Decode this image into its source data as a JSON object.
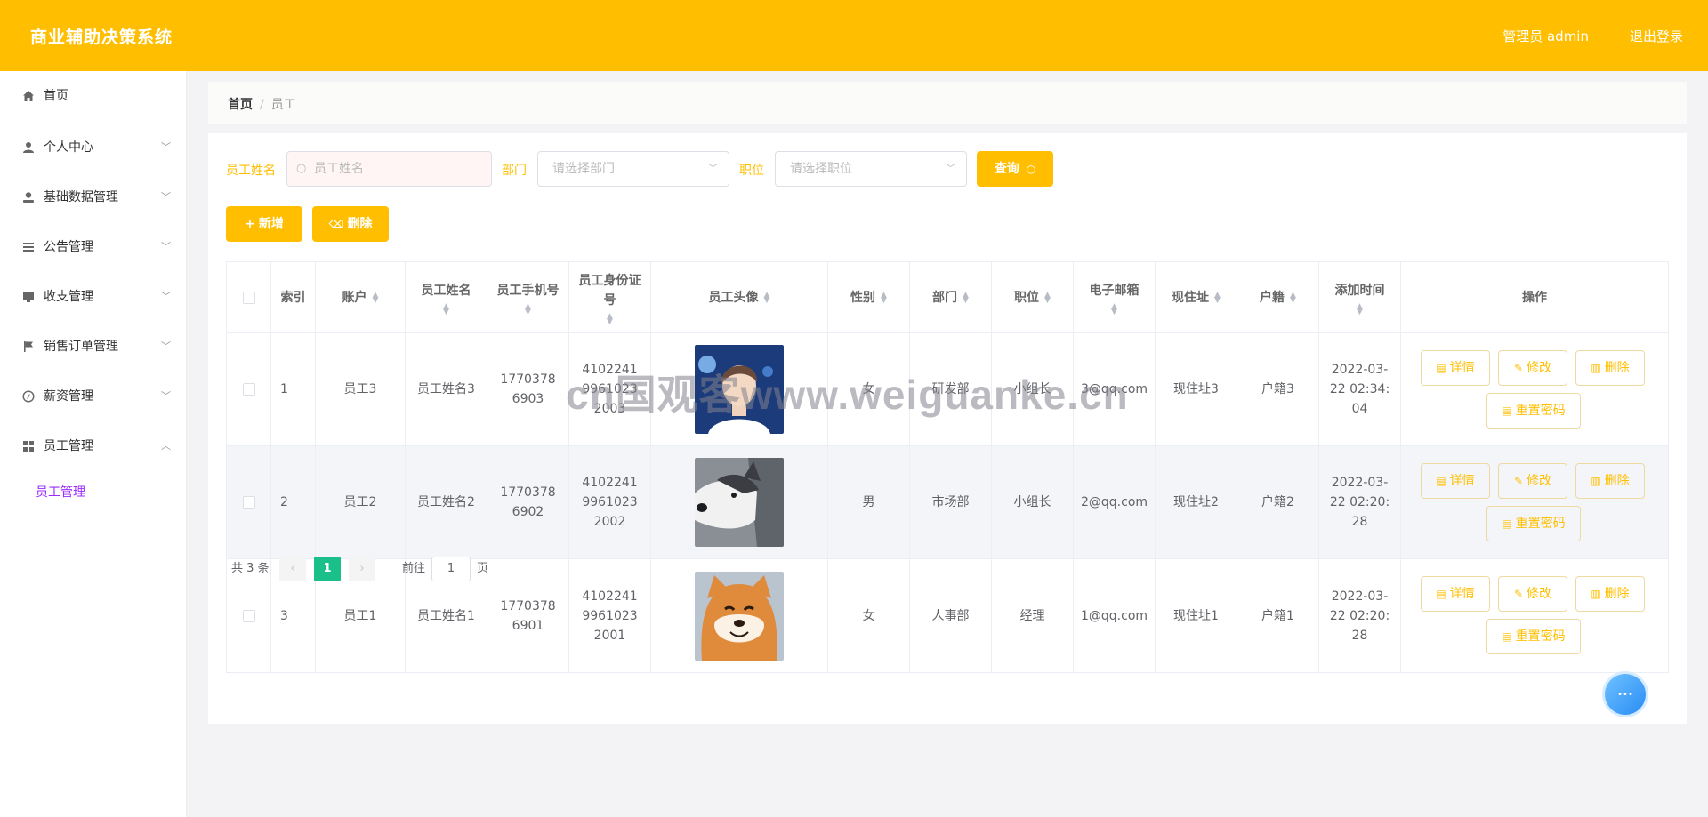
{
  "header": {
    "title": "商业辅助决策系统",
    "user": "管理员 admin",
    "logout": "退出登录"
  },
  "sidebar": {
    "items": [
      {
        "label": "首页",
        "icon": "home-icon",
        "expandable": false
      },
      {
        "label": "个人中心",
        "icon": "user-icon",
        "expandable": true
      },
      {
        "label": "基础数据管理",
        "icon": "person-icon",
        "expandable": true
      },
      {
        "label": "公告管理",
        "icon": "list-icon",
        "expandable": true
      },
      {
        "label": "收支管理",
        "icon": "monitor-icon",
        "expandable": true
      },
      {
        "label": "销售订单管理",
        "icon": "flag-icon",
        "expandable": true
      },
      {
        "label": "薪资管理",
        "icon": "compass-icon",
        "expandable": true
      },
      {
        "label": "员工管理",
        "icon": "grid-icon",
        "expandable": true,
        "expanded": true
      }
    ],
    "submenu_active": "员工管理"
  },
  "breadcrumb": {
    "home": "首页",
    "separator": "/",
    "current": "员工"
  },
  "search": {
    "name_label": "员工姓名",
    "name_placeholder": "员工姓名",
    "dept_label": "部门",
    "dept_placeholder": "请选择部门",
    "pos_label": "职位",
    "pos_placeholder": "请选择职位",
    "query_button": "查询"
  },
  "actions": {
    "add": "新增",
    "delete": "删除"
  },
  "table": {
    "columns": [
      "索引",
      "账户",
      "员工姓名",
      "员工手机号",
      "员工身份证号",
      "员工头像",
      "性别",
      "部门",
      "职位",
      "电子邮箱",
      "现住址",
      "户籍",
      "添加时间",
      "操作"
    ],
    "rows": [
      {
        "index": "1",
        "account": "员工3",
        "name": "员工姓名3",
        "phone": "17703786903",
        "id_card": "410224199610232003",
        "avatar": "person-photo",
        "gender": "女",
        "dept": "研发部",
        "position": "小组长",
        "email": "3@qq.com",
        "address": "现住址3",
        "hukou": "户籍3",
        "added": "2022-03-22 02:34:04"
      },
      {
        "index": "2",
        "account": "员工2",
        "name": "员工姓名2",
        "phone": "17703786902",
        "id_card": "410224199610232002",
        "avatar": "husky-photo",
        "gender": "男",
        "dept": "市场部",
        "position": "小组长",
        "email": "2@qq.com",
        "address": "现住址2",
        "hukou": "户籍2",
        "added": "2022-03-22 02:20:28"
      },
      {
        "index": "3",
        "account": "员工1",
        "name": "员工姓名1",
        "phone": "17703786901",
        "id_card": "410224199610232001",
        "avatar": "shiba-photo",
        "gender": "女",
        "dept": "人事部",
        "position": "经理",
        "email": "1@qq.com",
        "address": "现住址1",
        "hukou": "户籍1",
        "added": "2022-03-22 02:20:28"
      }
    ],
    "row_actions": {
      "detail": "详情",
      "edit": "修改",
      "delete": "删除",
      "reset": "重置密码"
    }
  },
  "pagination": {
    "total": "共 3 条",
    "current_page": "1",
    "goto_prefix": "前往",
    "goto_value": "1",
    "goto_suffix": "页"
  },
  "watermark": "cn国观客www.weiguanke.cn",
  "colors": {
    "accent": "#ffbf00",
    "page_active": "#1bbf8a",
    "submenu_active": "#9b2bff"
  }
}
